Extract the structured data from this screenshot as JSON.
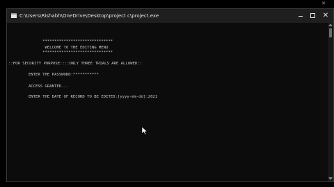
{
  "window": {
    "title": "C:\\Users\\Rishabh\\OneDrive\\Desktop\\project c\\project.exe",
    "minimize_icon": "minimize-icon",
    "maximize_icon": "maximize-icon",
    "close_icon": "close-icon"
  },
  "console": {
    "lines": [
      "              ******************************",
      "               WELCOME TO THE EDITING MENU",
      "              ******************************",
      "::FOR SECURITY PURPOSE::::ONLY THREE TRIALS ARE ALLOWED::",
      "        ENTER THE PASSWORD:***********",
      "        ACCESS GRANTED...",
      "        ENTER THE DATE OF RECORD TO BE EDITED:[yyyy-mm-dd]:2021"
    ]
  },
  "background_window": {
    "close_glyph": "✕"
  },
  "colors": {
    "console_bg": "#0c0c0c",
    "console_text": "#cccccc",
    "titlebar_bg": "#1f1f1f"
  }
}
